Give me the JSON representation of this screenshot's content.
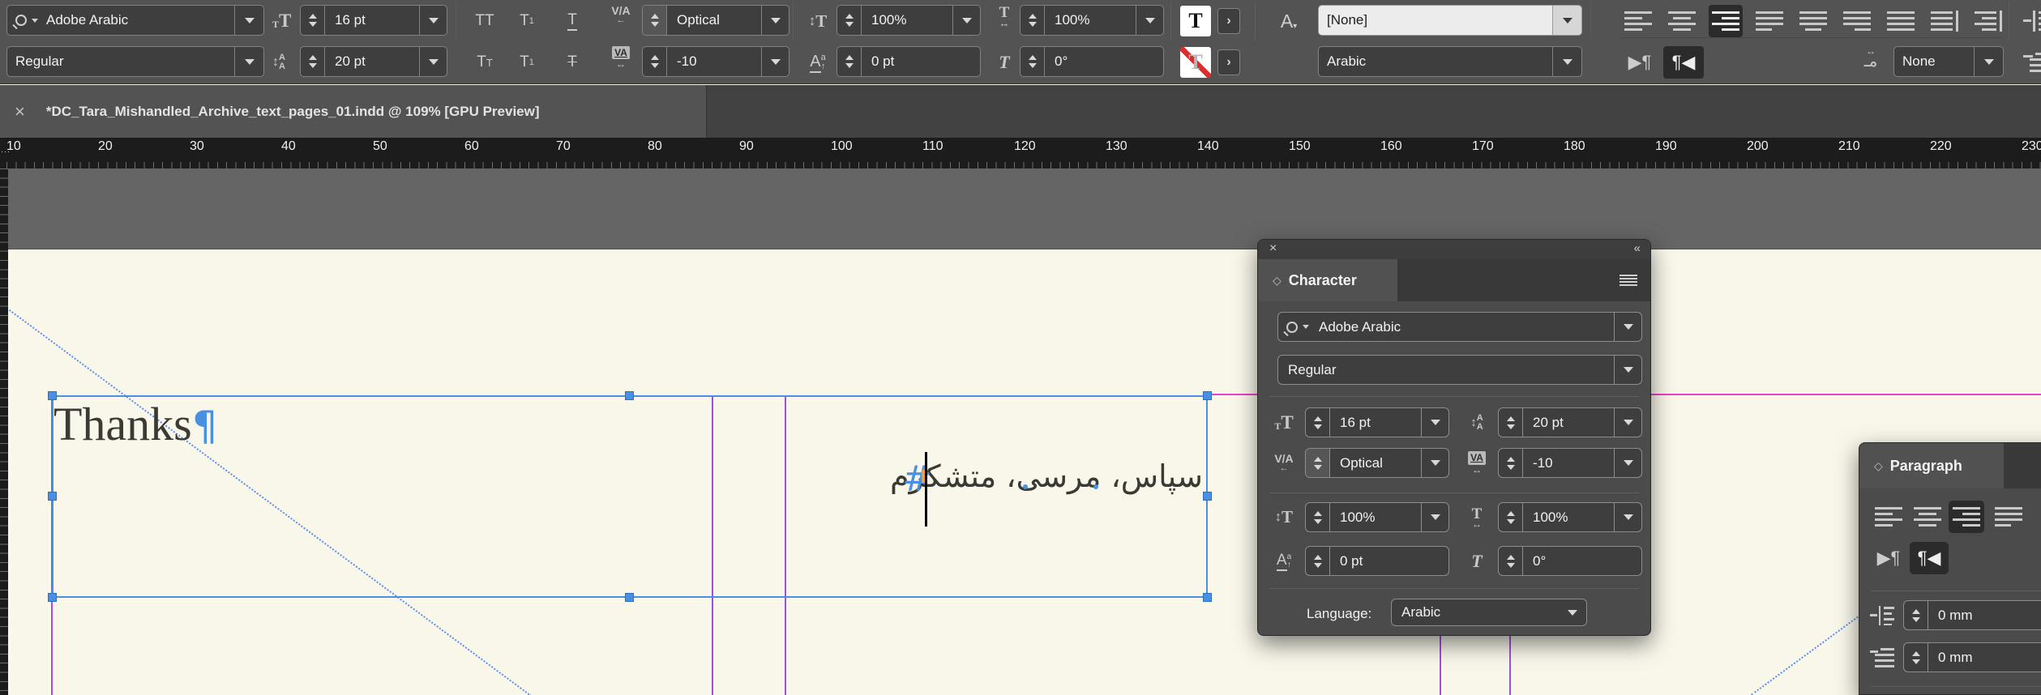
{
  "toolbar": {
    "font_name": "Adobe Arabic",
    "font_style": "Regular",
    "font_size": "16 pt",
    "leading": "20 pt",
    "kerning": "Optical",
    "tracking": "-10",
    "vertical_scale": "100%",
    "horizontal_scale": "100%",
    "baseline_shift": "0 pt",
    "skew": "0°",
    "character_style": "[None]",
    "language": "Arabic",
    "kashida": "None",
    "more_button": "›"
  },
  "icons": {
    "all_caps": "TT",
    "superscript_t": "T",
    "superscript_mark": "1",
    "underline_t": "T",
    "small_caps_big": "T",
    "small_caps_small": "T",
    "subscript_t": "T",
    "subscript_mark": "1",
    "strikethrough_t": "T",
    "kerning_label": "V/A",
    "kerning_arrow": "←",
    "tracking_label": "VA",
    "tracking_arrow": "↔",
    "vscale_arrow": "↕",
    "vscale_t": "T",
    "hscale_t": "T",
    "hscale_arrow": "↔",
    "baseline_a": "A",
    "baseline_sup": "a",
    "baseline_arrow": "↑",
    "skew_t": "T",
    "char_style_a": "A",
    "char_style_caret": "▾",
    "fill_t": "T",
    "stroke_t": "T",
    "size_small_t": "T",
    "size_big_t": "T",
    "leading_arrow": "↕",
    "leading_a1": "A",
    "leading_a2": "A",
    "dir_ltr": "▶¶",
    "dir_rtl": "¶◀",
    "kashida_glyph": "مـ",
    "kashida_arrow": "↔",
    "panel_diamond": "◇",
    "panel_close": "×",
    "panel_collapse": "«",
    "tab_close": "×"
  },
  "document_tab": {
    "title": "*DC_Tara_Mishandled_Archive_text_pages_01.indd @ 109% [GPU Preview]"
  },
  "ruler": {
    "labels": [
      "10",
      "20",
      "30",
      "40",
      "50",
      "60",
      "70",
      "80",
      "90",
      "100",
      "110",
      "120",
      "130",
      "140",
      "150",
      "160",
      "170",
      "180",
      "190",
      "200",
      "210",
      "220",
      "230"
    ],
    "corner_dots": "···"
  },
  "canvas": {
    "heading_text": "Thanks",
    "pilcrow": "¶",
    "arabic_text": "سپاس، مرسی، متشکرم",
    "end_of_story_marker": "#"
  },
  "character_panel": {
    "title": "Character",
    "font_name": "Adobe Arabic",
    "font_style": "Regular",
    "font_size": "16 pt",
    "leading": "20 pt",
    "kerning": "Optical",
    "tracking": "-10",
    "vertical_scale": "100%",
    "horizontal_scale": "100%",
    "baseline_shift": "0 pt",
    "skew": "0°",
    "language_label": "Language:",
    "language": "Arabic"
  },
  "paragraph_panel": {
    "title": "Paragraph",
    "left_indent": "0 mm",
    "first_line_indent": "0 mm"
  },
  "colors": {
    "accent_blue": "#4a90e2",
    "guide_purple": "#a050e0",
    "guide_pink": "#ee3fc8",
    "diagonal_blue": "#5b8def",
    "page_cream": "#f9f7ea",
    "pasteboard_gray": "#656565",
    "toolbar_gray": "#535353",
    "stroke_none_red": "#d62f2f",
    "cursor_orange": "#f0a030"
  }
}
